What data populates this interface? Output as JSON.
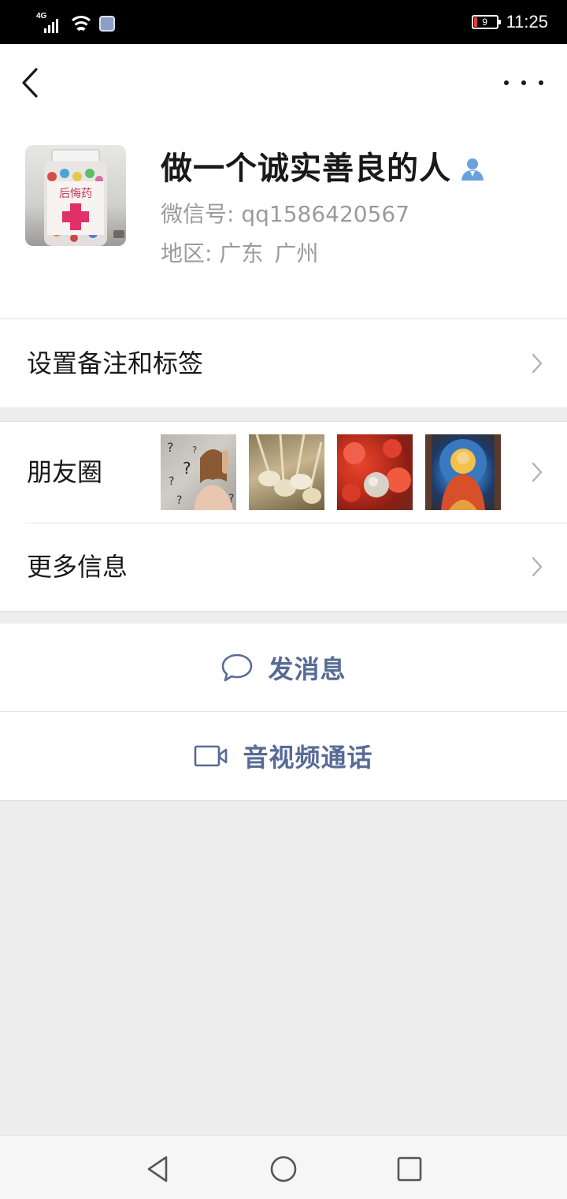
{
  "status_bar": {
    "network": "4G",
    "battery_level": "9",
    "time": "11:25"
  },
  "nav": {
    "back_icon": "back-chevron-icon",
    "more_icon": "more-dots-icon"
  },
  "profile": {
    "avatar_icon": "avatar-image",
    "avatar_text": "后悔药",
    "name": "做一个诚实善良的人",
    "badge_icon": "contact-person-icon",
    "wechat_id": "微信号: qq1586420567",
    "region_label": "地区:",
    "region_province": "广东",
    "region_city": "广州"
  },
  "rows": {
    "remark_tags": "设置备注和标签",
    "moments": "朋友圈",
    "more_info": "更多信息"
  },
  "moments_thumbs": [
    "question-marks-woman",
    "mushrooms",
    "red-cells",
    "buddha-thangka"
  ],
  "actions": {
    "message": "发消息",
    "call": "音视频通话"
  },
  "colors": {
    "link_blue": "#576b95",
    "background": "#ededed",
    "secondary_text": "#9b9b9b"
  }
}
